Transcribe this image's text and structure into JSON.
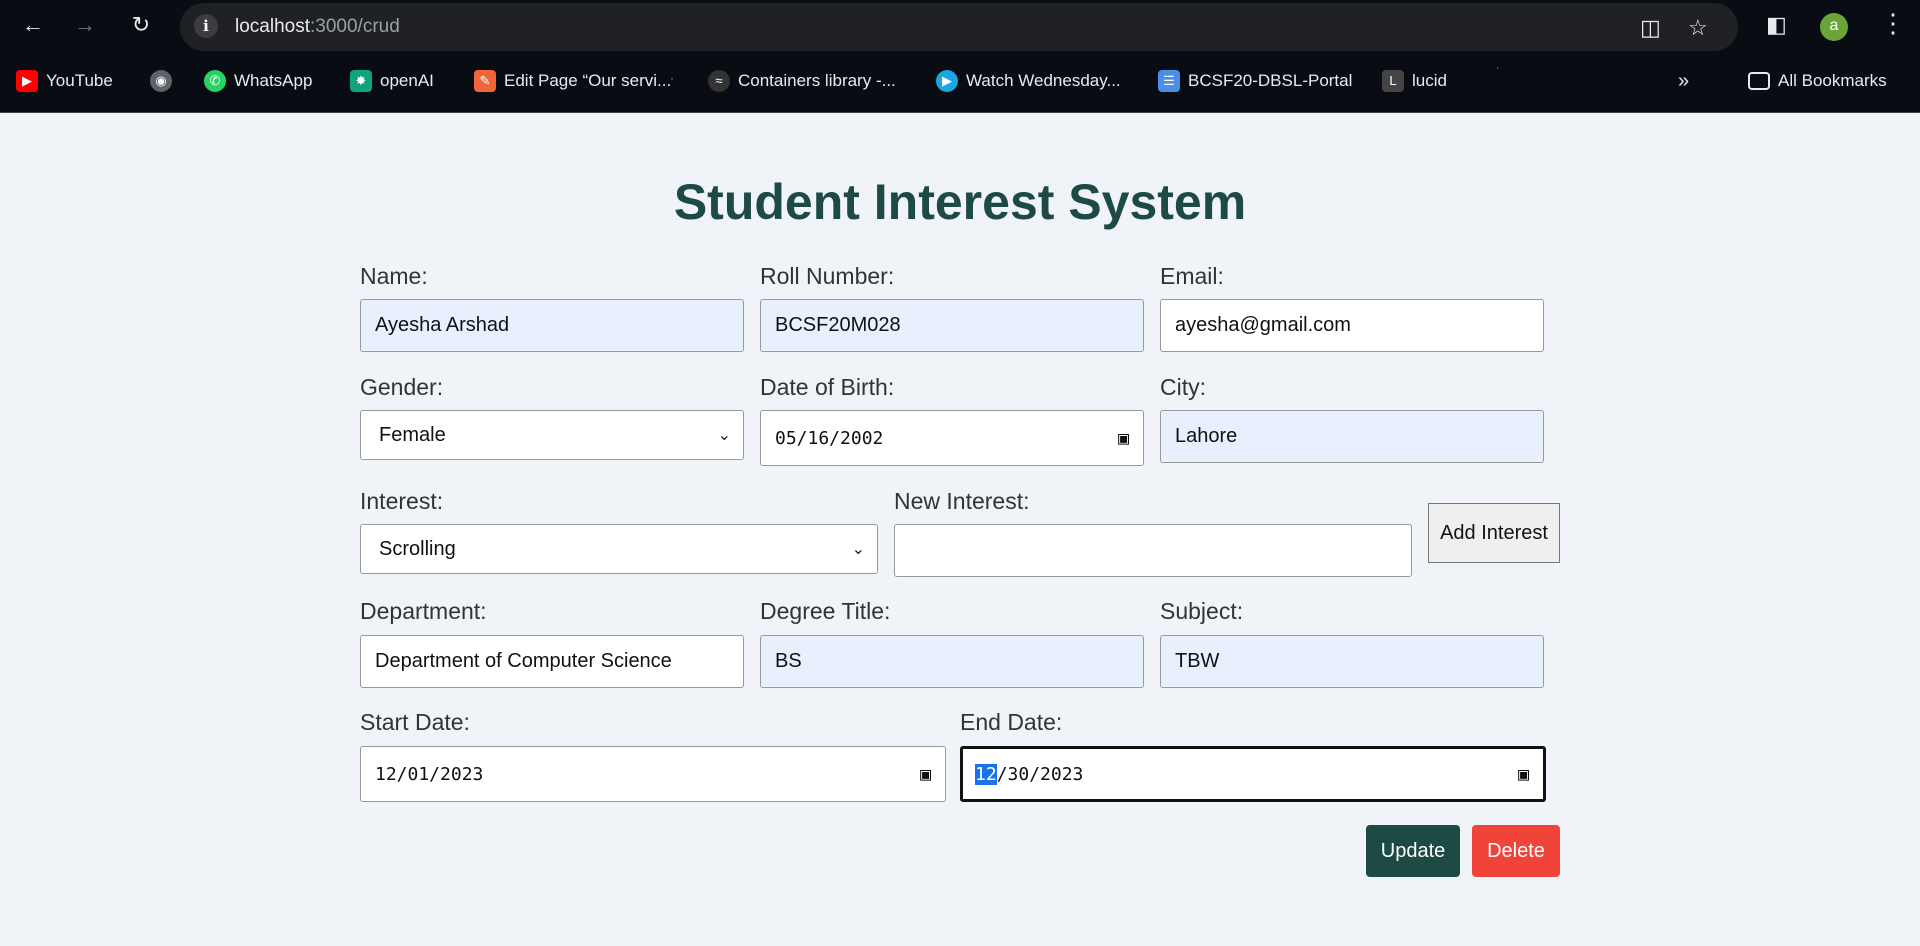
{
  "browser": {
    "url_host": "localhost",
    "url_path": ":3000/crud",
    "profile_initial": "a",
    "bookmarks": [
      {
        "label": "YouTube",
        "icon": "youtube-icon",
        "color": "#ff0000"
      },
      {
        "label": "",
        "icon": "globe-icon",
        "color": "#5f6368"
      },
      {
        "label": "WhatsApp",
        "icon": "whatsapp-icon",
        "color": "#25d366"
      },
      {
        "label": "openAI",
        "icon": "openai-icon",
        "color": "#10a37f"
      },
      {
        "label": "Edit Page “Our servi...",
        "icon": "edit-page-icon",
        "color": "#f0653a"
      },
      {
        "label": "Containers library -...",
        "icon": "containers-icon",
        "color": "#5f6368"
      },
      {
        "label": "Watch Wednesday...",
        "icon": "play-icon",
        "color": "#1aa7e0"
      },
      {
        "label": "BCSF20-DBSL-Portal",
        "icon": "database-icon",
        "color": "#4a8fe7"
      },
      {
        "label": "lucid",
        "icon": "lucid-icon",
        "color": "#444444"
      }
    ],
    "all_bookmarks": "All Bookmarks"
  },
  "form": {
    "title": "Student Interest System",
    "name_label": "Name:",
    "name_value": "Ayesha Arshad",
    "roll_label": "Roll Number:",
    "roll_value": "BCSF20M028",
    "email_label": "Email:",
    "email_value": "ayesha@gmail.com",
    "gender_label": "Gender:",
    "gender_value": "Female",
    "dob_label": "Date of Birth:",
    "dob_value": "05/16/2002",
    "city_label": "City:",
    "city_value": "Lahore",
    "interest_label": "Interest:",
    "interest_value": "Scrolling",
    "new_interest_label": "New Interest:",
    "new_interest_value": "",
    "add_interest_button": "Add Interest",
    "department_label": "Department:",
    "department_value": "Department of Computer Science",
    "degree_label": "Degree Title:",
    "degree_value": "BS",
    "subject_label": "Subject:",
    "subject_value": "TBW",
    "start_label": "Start Date:",
    "start_value": "12/01/2023",
    "end_label": "End Date:",
    "end_month": "12",
    "end_rest": "/30/2023",
    "update_button": "Update",
    "delete_button": "Delete"
  },
  "colors": {
    "title": "#1d4a44",
    "update": "#1e4a44",
    "delete": "#f0443a",
    "autofill": "#e8effd"
  }
}
